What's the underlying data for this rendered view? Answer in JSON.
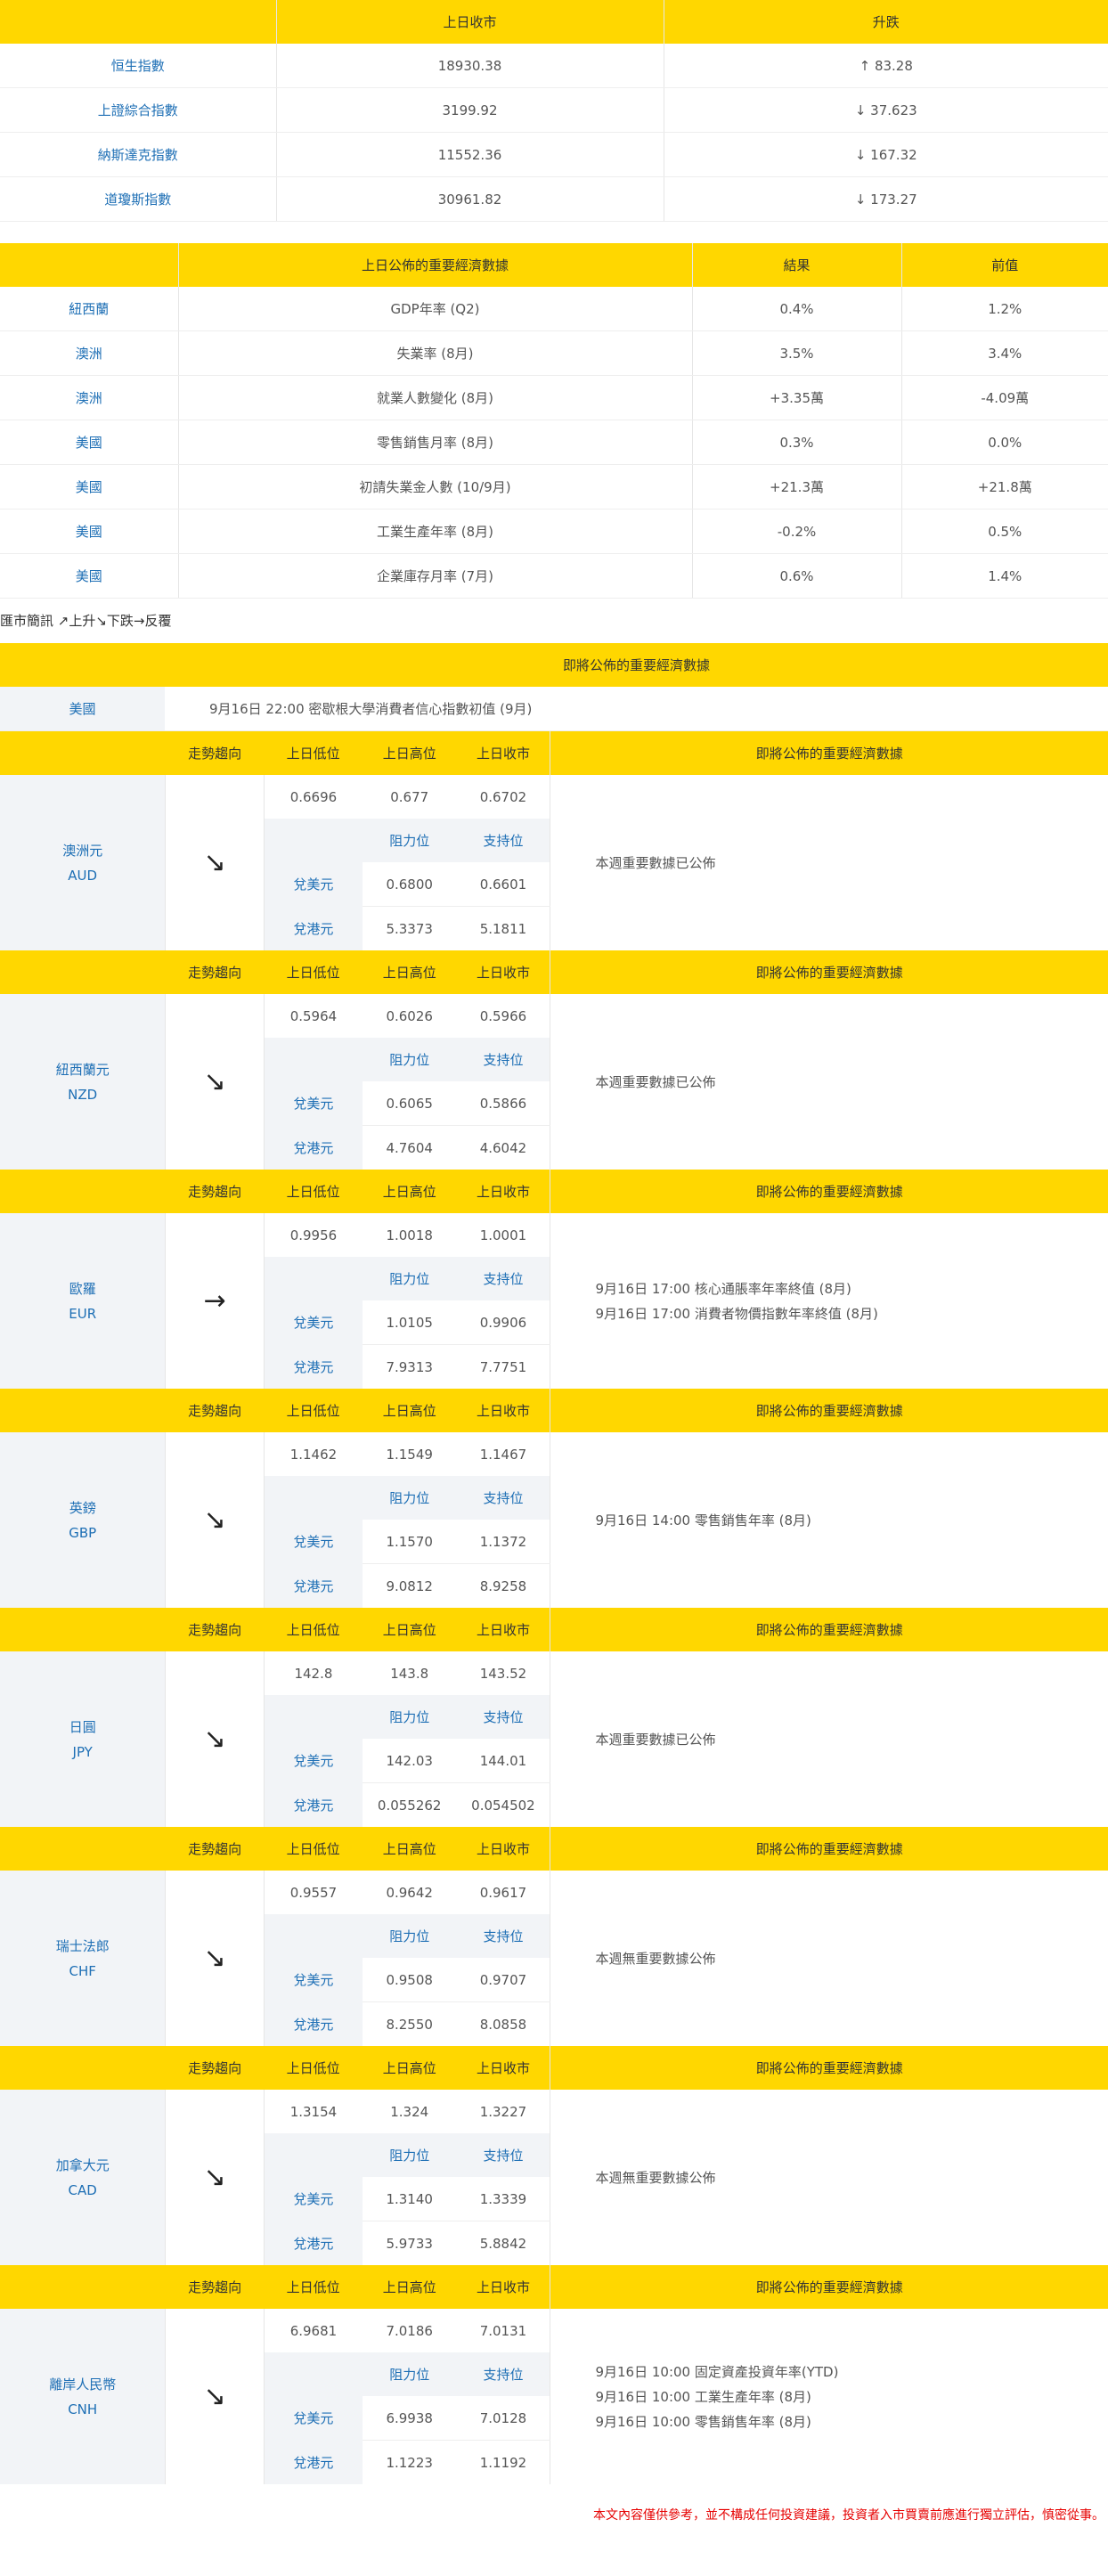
{
  "index_table": {
    "headers": [
      "",
      "上日收市",
      "升跌"
    ],
    "rows": [
      {
        "name": "恒生指數",
        "close": "18930.38",
        "change": "↑ 83.28"
      },
      {
        "name": "上證綜合指數",
        "close": "3199.92",
        "change": "↓ 37.623"
      },
      {
        "name": "納斯達克指數",
        "close": "11552.36",
        "change": "↓ 167.32"
      },
      {
        "name": "道瓊斯指數",
        "close": "30961.82",
        "change": "↓ 173.27"
      }
    ]
  },
  "econ_table": {
    "headers": [
      "",
      "上日公佈的重要經濟數據",
      "結果",
      "前值"
    ],
    "rows": [
      {
        "country": "紐西蘭",
        "item": "GDP年率 (Q2)",
        "result": "0.4%",
        "prev": "1.2%"
      },
      {
        "country": "澳洲",
        "item": "失業率 (8月)",
        "result": "3.5%",
        "prev": "3.4%"
      },
      {
        "country": "澳洲",
        "item": "就業人數變化 (8月)",
        "result": "+3.35萬",
        "prev": "-4.09萬"
      },
      {
        "country": "美國",
        "item": "零售銷售月率 (8月)",
        "result": "0.3%",
        "prev": "0.0%"
      },
      {
        "country": "美國",
        "item": "初請失業金人數 (10/9月)",
        "result": "+21.3萬",
        "prev": "+21.8萬"
      },
      {
        "country": "美國",
        "item": "工業生產年率 (8月)",
        "result": "-0.2%",
        "prev": "0.5%"
      },
      {
        "country": "美國",
        "item": "企業庫存月率 (7月)",
        "result": "0.6%",
        "prev": "1.4%"
      }
    ]
  },
  "legend": "匯市簡訊 ↗上升↘下跌→反覆",
  "upcoming": {
    "header": "即將公佈的重要經濟數據",
    "country": "美國",
    "text": "9月16日 22:00 密歇根大學消費者信心指數初值 (9月)"
  },
  "currency_headers": {
    "trend": "走勢趨向",
    "low": "上日低位",
    "high": "上日高位",
    "close": "上日收市",
    "events": "即將公佈的重要經濟數據",
    "resistance": "阻力位",
    "support": "支持位"
  },
  "currencies": [
    {
      "name": "澳洲元",
      "code": "AUD",
      "arrow": "↘",
      "low": "0.6696",
      "high": "0.677",
      "close": "0.6702",
      "usd_label": "兌美元",
      "usd_res": "0.6800",
      "usd_sup": "0.6601",
      "hkd_label": "兌港元",
      "hkd_res": "5.3373",
      "hkd_sup": "5.1811",
      "events": [
        "本週重要數據已公佈"
      ]
    },
    {
      "name": "紐西蘭元",
      "code": "NZD",
      "arrow": "↘",
      "low": "0.5964",
      "high": "0.6026",
      "close": "0.5966",
      "usd_label": "兌美元",
      "usd_res": "0.6065",
      "usd_sup": "0.5866",
      "hkd_label": "兌港元",
      "hkd_res": "4.7604",
      "hkd_sup": "4.6042",
      "events": [
        "本週重要數據已公佈"
      ]
    },
    {
      "name": "歐羅",
      "code": "EUR",
      "arrow": "→",
      "low": "0.9956",
      "high": "1.0018",
      "close": "1.0001",
      "usd_label": "兌美元",
      "usd_res": "1.0105",
      "usd_sup": "0.9906",
      "hkd_label": "兌港元",
      "hkd_res": "7.9313",
      "hkd_sup": "7.7751",
      "events": [
        "9月16日 17:00 核心通脹率年率終值 (8月)",
        "9月16日 17:00 消費者物價指數年率終值 (8月)"
      ]
    },
    {
      "name": "英鎊",
      "code": "GBP",
      "arrow": "↘",
      "low": "1.1462",
      "high": "1.1549",
      "close": "1.1467",
      "usd_label": "兌美元",
      "usd_res": "1.1570",
      "usd_sup": "1.1372",
      "hkd_label": "兌港元",
      "hkd_res": "9.0812",
      "hkd_sup": "8.9258",
      "events": [
        "9月16日 14:00 零售銷售年率 (8月)"
      ]
    },
    {
      "name": "日圓",
      "code": "JPY",
      "arrow": "↘",
      "low": "142.8",
      "high": "143.8",
      "close": "143.52",
      "usd_label": "兌美元",
      "usd_res": "142.03",
      "usd_sup": "144.01",
      "hkd_label": "兌港元",
      "hkd_res": "0.055262",
      "hkd_sup": "0.054502",
      "events": [
        "本週重要數據已公佈"
      ]
    },
    {
      "name": "瑞士法郎",
      "code": "CHF",
      "arrow": "↘",
      "low": "0.9557",
      "high": "0.9642",
      "close": "0.9617",
      "usd_label": "兌美元",
      "usd_res": "0.9508",
      "usd_sup": "0.9707",
      "hkd_label": "兌港元",
      "hkd_res": "8.2550",
      "hkd_sup": "8.0858",
      "events": [
        "本週無重要數據公佈"
      ]
    },
    {
      "name": "加拿大元",
      "code": "CAD",
      "arrow": "↘",
      "low": "1.3154",
      "high": "1.324",
      "close": "1.3227",
      "usd_label": "兌美元",
      "usd_res": "1.3140",
      "usd_sup": "1.3339",
      "hkd_label": "兌港元",
      "hkd_res": "5.9733",
      "hkd_sup": "5.8842",
      "events": [
        "本週無重要數據公佈"
      ]
    },
    {
      "name": "離岸人民幣",
      "code": "CNH",
      "arrow": "↘",
      "low": "6.9681",
      "high": "7.0186",
      "close": "7.0131",
      "usd_label": "兌美元",
      "usd_res": "6.9938",
      "usd_sup": "7.0128",
      "hkd_label": "兌港元",
      "hkd_res": "1.1223",
      "hkd_sup": "1.1192",
      "events": [
        "9月16日 10:00 固定資產投資年率(YTD)",
        "9月16日 10:00 工業生產年率 (8月)",
        "9月16日 10:00 零售銷售年率 (8月)"
      ]
    }
  ],
  "disclaimer": "本文內容僅供參考，並不構成任何投資建議，投資者入市買賣前應進行獨立評估，慎密從事。"
}
